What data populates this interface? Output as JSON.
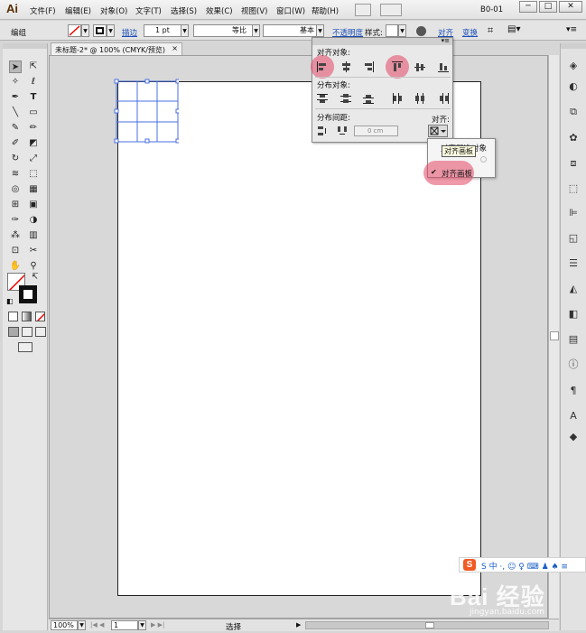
{
  "app": {
    "logo": "Ai"
  },
  "menubar": {
    "items": [
      "文件(F)",
      "编辑(E)",
      "对象(O)",
      "文字(T)",
      "选择(S)",
      "效果(C)",
      "视图(V)",
      "窗口(W)",
      "帮助(H)"
    ],
    "workspace": "B0-01",
    "win_buttons": [
      "─",
      "□",
      "✕"
    ]
  },
  "controlbar": {
    "mode": "编组",
    "stroke_link": "描边",
    "stroke_weight": "1 pt",
    "profile": "等比",
    "brush": "基本",
    "opacity_link": "不透明度",
    "style_label": "样式:",
    "align_link": "对齐",
    "transform_link": "变换"
  },
  "document": {
    "tab_title": "未标题-2* @ 100% (CMYK/预览)",
    "tab_close": "×"
  },
  "align_panel": {
    "section_align": "对齐对象:",
    "section_distribute": "分布对象:",
    "section_spacing": "分布间距:",
    "align_to_label": "对齐:",
    "spacing_value": "0 cm"
  },
  "align_to_menu": {
    "option_objects": "对齐所选对象",
    "option_artboard": "对齐画板",
    "tooltip": "对齐画板",
    "checkmark": "✔"
  },
  "statusbar": {
    "zoom": "100%",
    "page": "1",
    "tool": "选择"
  },
  "watermark": {
    "ime": "S 中 ·, ☺ ♀ ⌨ ♟ ♠ ≡",
    "brand": "Bai 经验",
    "url": "jingyan.baidu.com"
  },
  "colors": {
    "highlight": "#e24664",
    "artboard": "#ffffff",
    "selection": "#4a6fe0"
  }
}
